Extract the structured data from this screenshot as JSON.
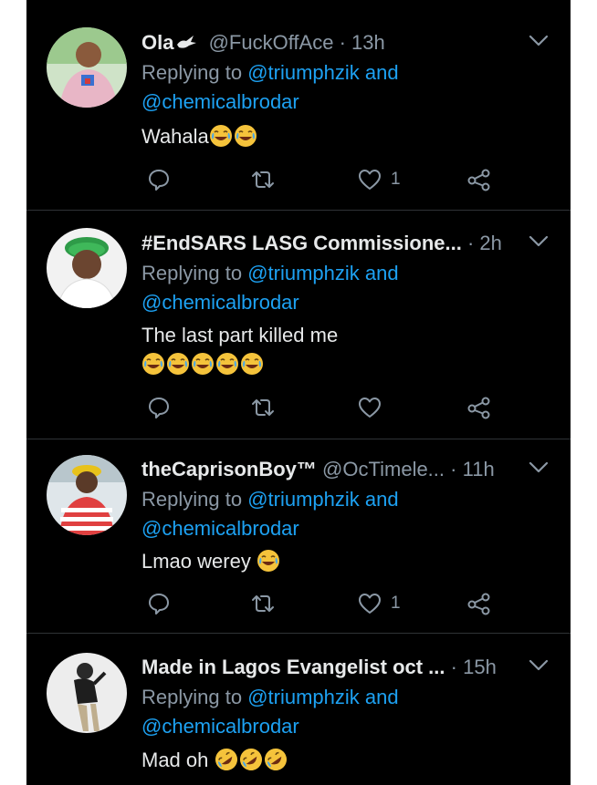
{
  "tweets": [
    {
      "name": "Ola",
      "handle": "@FuckOffAce",
      "separator": "·",
      "time": "13h",
      "replying_prefix": "Replying to",
      "mention1": "@triumphzik",
      "and_word": "and",
      "mention2": "@chemicalbrodar",
      "text": "Wahala",
      "emojis": [
        "joy",
        "joy"
      ],
      "like_count": "1",
      "name_badge_icon": "dove-icon"
    },
    {
      "name": "#EndSARS LASG Commissione...",
      "handle": "",
      "separator": "·",
      "time": "2h",
      "replying_prefix": "Replying to",
      "mention1": "@triumphzik",
      "and_word": "and",
      "mention2": "@chemicalbrodar",
      "text": "The last part killed me",
      "emojis": [
        "joy",
        "joy",
        "joy",
        "joy",
        "joy"
      ],
      "like_count": ""
    },
    {
      "name": "theCaprisonBoy™",
      "handle": "@OcTimele...",
      "separator": "·",
      "time": "11h",
      "replying_prefix": "Replying to",
      "mention1": "@triumphzik",
      "and_word": "and",
      "mention2": "@chemicalbrodar",
      "text": "Lmao werey",
      "emojis": [
        "joy"
      ],
      "like_count": "1"
    },
    {
      "name": "Made in Lagos Evangelist oct ...",
      "handle": "",
      "separator": "·",
      "time": "15h",
      "replying_prefix": "Replying to",
      "mention1": "@triumphzik",
      "and_word": "and",
      "mention2": "@chemicalbrodar",
      "text": "Mad oh",
      "emojis": [
        "rofl",
        "rofl",
        "rofl"
      ],
      "like_count": ""
    }
  ],
  "icons": {
    "reply": "reply-icon",
    "retweet": "retweet-icon",
    "like": "heart-icon",
    "share": "share-icon",
    "menu": "chevron-down-icon"
  },
  "colors": {
    "background": "#000000",
    "primary_text": "#e7e9ea",
    "secondary_text": "#8b98a5",
    "link": "#1da1f2",
    "divider": "#2f3336"
  }
}
